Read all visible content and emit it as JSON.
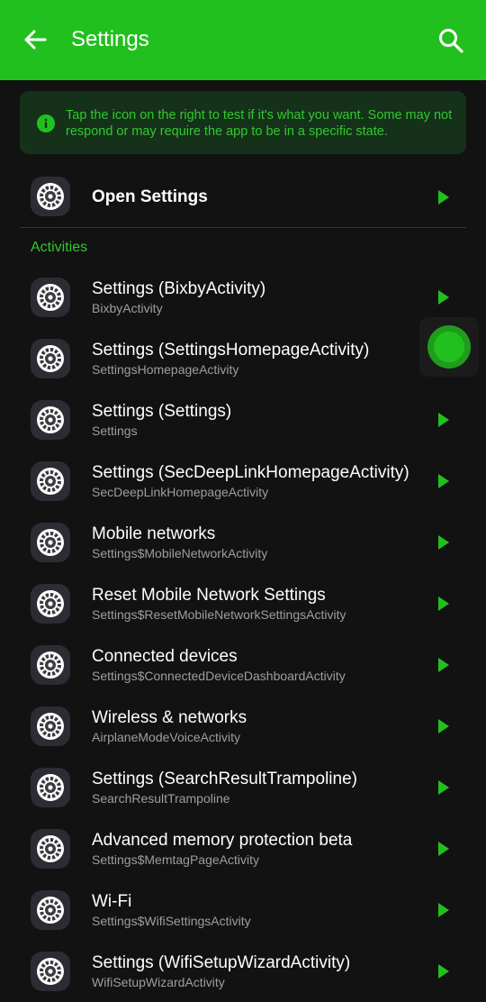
{
  "colors": {
    "accent": "#22c01f",
    "background": "#121212",
    "info_background": "#15311a",
    "info_text": "#2fca2c",
    "subtitle": "#9e9e9e"
  },
  "appbar": {
    "title": "Settings",
    "back_icon": "arrow-left-icon",
    "search_icon": "search-icon"
  },
  "info": {
    "icon": "info-icon",
    "text": "Tap the icon on the right to test if it's what you want. Some may not respond or may require the app to be in a specific state."
  },
  "open_settings": {
    "label": "Open Settings",
    "icon": "settings-gear-icon",
    "action_icon": "play-icon"
  },
  "section": {
    "label": "Activities"
  },
  "activities": [
    {
      "title": "Settings (BixbyActivity)",
      "subtitle": "BixbyActivity"
    },
    {
      "title": "Settings (SettingsHomepageActivity)",
      "subtitle": "SettingsHomepageActivity"
    },
    {
      "title": "Settings (Settings)",
      "subtitle": "Settings"
    },
    {
      "title": "Settings (SecDeepLinkHomepageActivity)",
      "subtitle": "SecDeepLinkHomepageActivity"
    },
    {
      "title": "Mobile networks",
      "subtitle": "Settings$MobileNetworkActivity"
    },
    {
      "title": "Reset Mobile Network Settings",
      "subtitle": "Settings$ResetMobileNetworkSettingsActivity"
    },
    {
      "title": "Connected devices",
      "subtitle": "Settings$ConnectedDeviceDashboardActivity"
    },
    {
      "title": "Wireless & networks",
      "subtitle": "AirplaneModeVoiceActivity"
    },
    {
      "title": "Settings (SearchResultTrampoline)",
      "subtitle": "SearchResultTrampoline"
    },
    {
      "title": "Advanced memory protection beta",
      "subtitle": "Settings$MemtagPageActivity"
    },
    {
      "title": "Wi-Fi",
      "subtitle": "Settings$WifiSettingsActivity"
    },
    {
      "title": "Settings (WifiSetupWizardActivity)",
      "subtitle": "WifiSetupWizardActivity"
    }
  ],
  "floating_button": {
    "icon": "floating-bubble-icon"
  }
}
